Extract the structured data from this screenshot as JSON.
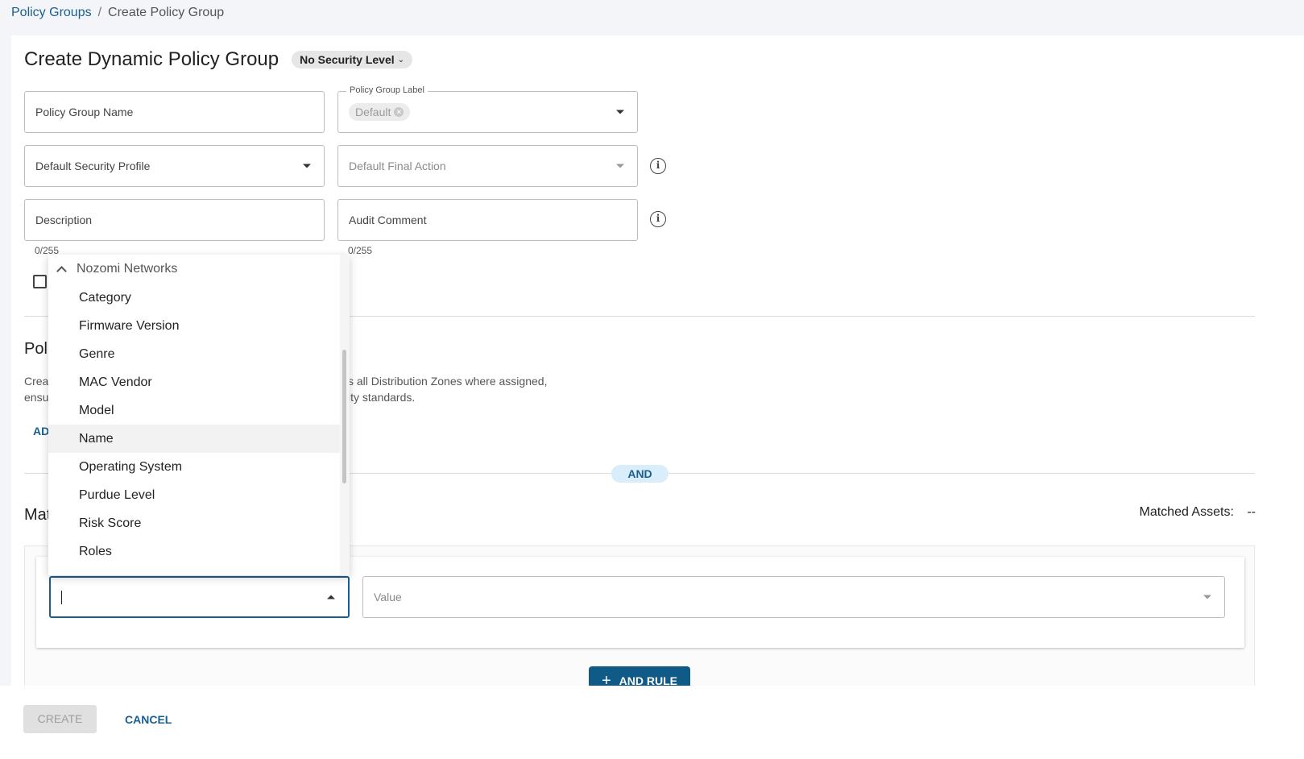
{
  "breadcrumb": {
    "parent": "Policy Groups",
    "separator": "/",
    "current": "Create Policy Group"
  },
  "header": {
    "title": "Create Dynamic Policy Group",
    "security_level": "No Security Level"
  },
  "form": {
    "name_placeholder": "Policy Group Name",
    "label_field_label": "Policy Group Label",
    "label_chip": "Default",
    "security_profile_placeholder": "Default Security Profile",
    "final_action_placeholder": "Default Final Action",
    "description_placeholder": "Description",
    "description_counter": "0/255",
    "audit_placeholder": "Audit Comment",
    "audit_counter": "0/255"
  },
  "policies": {
    "heading": "Poli",
    "desc_left_1": "Crea",
    "desc_left_2": "ensu",
    "desc_right_1": "s all Distribution Zones where assigned,",
    "desc_right_2": "ity standards.",
    "add_link": "AD"
  },
  "and_pill": "AND",
  "matching": {
    "heading": "Mat",
    "matched_label": "Matched Assets:",
    "matched_value": "--"
  },
  "rule": {
    "attribute_value": "",
    "value_placeholder": "Value",
    "add_rule_label": "AND RULE"
  },
  "footer": {
    "create": "CREATE",
    "cancel": "CANCEL"
  },
  "dropdown": {
    "group": "Nozomi Networks",
    "items": [
      "Category",
      "Firmware Version",
      "Genre",
      "MAC Vendor",
      "Model",
      "Name",
      "Operating System",
      "Purdue Level",
      "Risk Score",
      "Roles"
    ],
    "highlighted": "Name"
  },
  "colors": {
    "accent": "#1b5f8f",
    "primary_button": "#0f5a86",
    "pill_bg": "#d9edfa"
  }
}
